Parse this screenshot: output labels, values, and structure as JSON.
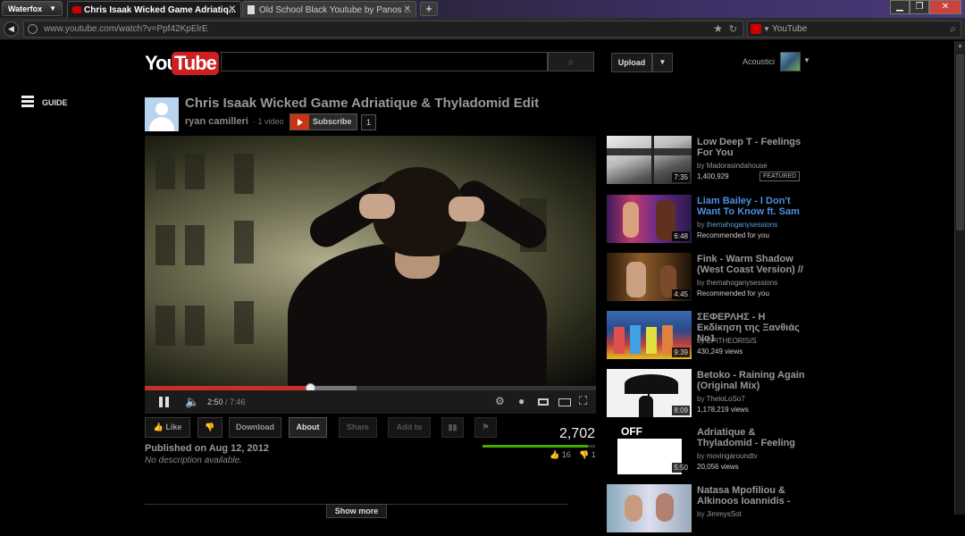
{
  "browser": {
    "app_button": "Waterfox",
    "tabs": [
      {
        "title": "Chris Isaak Wicked Game Adriatiq..."
      },
      {
        "title": "Old School Black Youtube by Panos ..."
      }
    ],
    "url": "www.youtube.com/watch?v=Ppf42KpElrE",
    "search_engine": "YouTube"
  },
  "youtube": {
    "logo": {
      "you": "You",
      "tube": "Tube"
    },
    "upload_label": "Upload",
    "account_name": "Acoustici",
    "guide_label": "GUIDE"
  },
  "video": {
    "title": "Chris Isaak Wicked Game Adriatique & Thyladomid Edit",
    "channel": "ryan camilleri",
    "channel_videos": "· 1 video",
    "subscribe_label": "Subscribe",
    "subscriber_count": "1",
    "current_time": "2:50",
    "duration": "/ 7:46",
    "played_fraction": 0.366,
    "buffered_fraction": 0.47,
    "published": "Published on Aug 12, 2012",
    "description": "No description available.",
    "views": "2,702",
    "likes": "16",
    "dislikes": "1",
    "like_fraction": 0.94,
    "show_more": "Show more"
  },
  "actions": {
    "like": "Like",
    "download": "Download",
    "about": "About",
    "share": "Share",
    "add_to": "Add to"
  },
  "related": [
    {
      "title": "Low Deep T - Feelings For You",
      "by_prefix": "by",
      "channel": "Madorasindahouse",
      "meta": "1,400,929",
      "duration": "7:35",
      "badge": "FEATURED",
      "highlight": false
    },
    {
      "title": "Liam Bailey - I Don't Want To Know ft. Sam",
      "by_prefix": "by",
      "channel": "themahoganysessions",
      "meta": "Recommended for you",
      "duration": "6:48",
      "highlight": true
    },
    {
      "title": "Fink - Warm Shadow (West Coast Version) //",
      "by_prefix": "by",
      "channel": "themahoganysessions",
      "meta": "Recommended for you",
      "duration": "4:45",
      "highlight": false
    },
    {
      "title": "ΣΕΦΕΡΛΗΣ - Η Εκδίκηση της Ξανθιάς Νο1",
      "by_prefix": "by",
      "channel": "EPITHEORISIS",
      "meta": "430,249 views",
      "duration": "9:39",
      "highlight": false
    },
    {
      "title": "Betoko - Raining Again (Original Mix)",
      "by_prefix": "by",
      "channel": "TheloLoSo7",
      "meta": "1,178,219 views",
      "duration": "8:09",
      "highlight": false
    },
    {
      "title": "Adriatique & Thyladomid - Feeling",
      "by_prefix": "by",
      "channel": "movingaroundtv",
      "meta": "20,056 views",
      "duration": "5:50",
      "thumb_text": "OFF",
      "highlight": false
    },
    {
      "title": "Natasa Mpofiliou & Alkinoos Ioannidis -",
      "by_prefix": "by",
      "channel": "JimmysSot",
      "meta": "",
      "duration": "",
      "highlight": false
    }
  ]
}
